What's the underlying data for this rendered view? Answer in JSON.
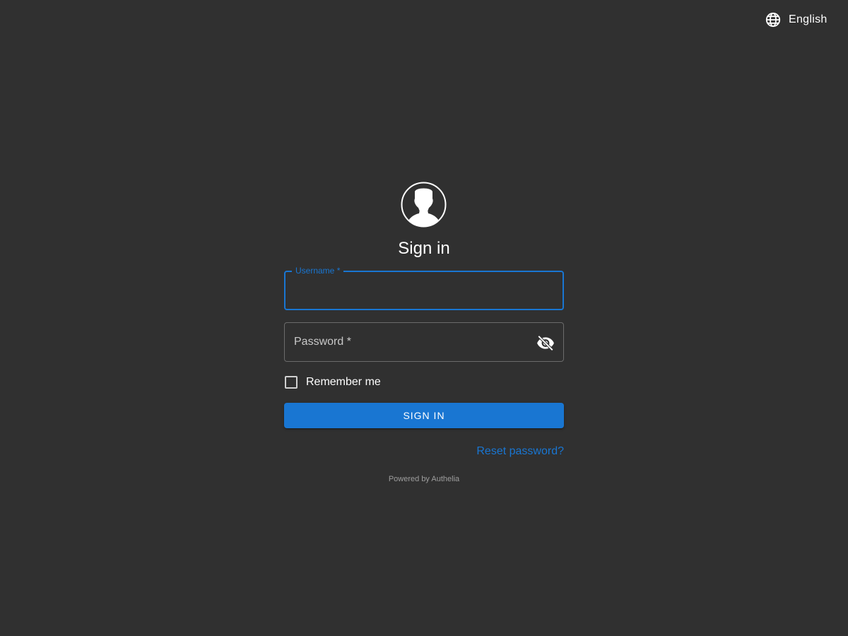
{
  "header": {
    "language": "English",
    "language_icon": "globe-icon"
  },
  "login": {
    "avatar_icon": "user-silhouette-icon",
    "title": "Sign in",
    "username": {
      "label": "Username *",
      "value": ""
    },
    "password": {
      "label": "Password *",
      "value": "",
      "visibility_icon": "eye-off-icon"
    },
    "remember_me": {
      "label": "Remember me",
      "checked": false
    },
    "sign_in_label": "SIGN IN",
    "reset_password_label": "Reset password?"
  },
  "footer": {
    "powered_by": "Powered by Authelia"
  },
  "colors": {
    "background": "#303030",
    "accent": "#1976d2",
    "text": "#ffffff",
    "muted": "#9e9e9e"
  }
}
